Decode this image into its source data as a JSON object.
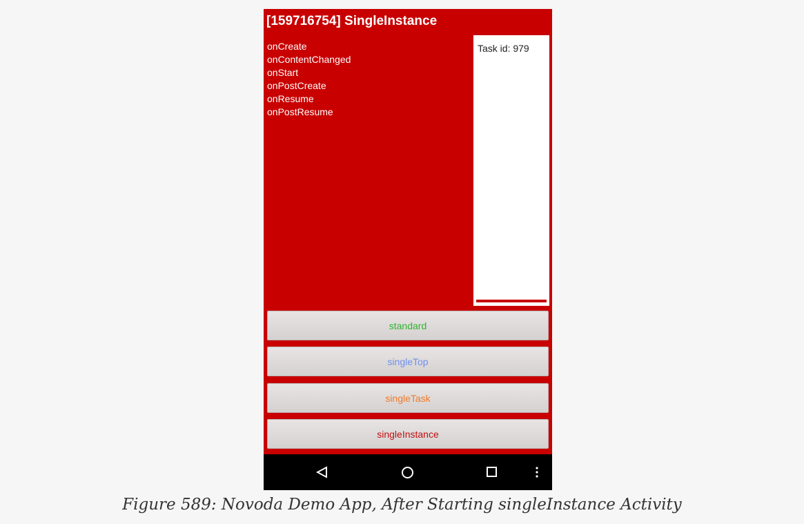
{
  "app": {
    "title": "[159716754] SingleInstance"
  },
  "lifecycle_log": [
    "onCreate",
    "onContentChanged",
    "onStart",
    "onPostCreate",
    "onResume",
    "onPostResume"
  ],
  "task_panel": {
    "label": "Task id: 979"
  },
  "buttons": [
    {
      "label": "standard",
      "color": "#2fb32f"
    },
    {
      "label": "singleTop",
      "color": "#6f8ff0"
    },
    {
      "label": "singleTask",
      "color": "#f07a2a"
    },
    {
      "label": "singleInstance",
      "color": "#c01010"
    }
  ],
  "nav": {
    "icons": [
      "back-triangle-icon",
      "home-circle-icon",
      "recents-square-icon",
      "overflow-dots-icon"
    ]
  },
  "caption": "Figure 589: Novoda Demo App, After Starting singleInstance Activity",
  "colors": {
    "app_background": "#c80000",
    "nav_background": "#000000",
    "page_background": "#f6f6f6"
  }
}
